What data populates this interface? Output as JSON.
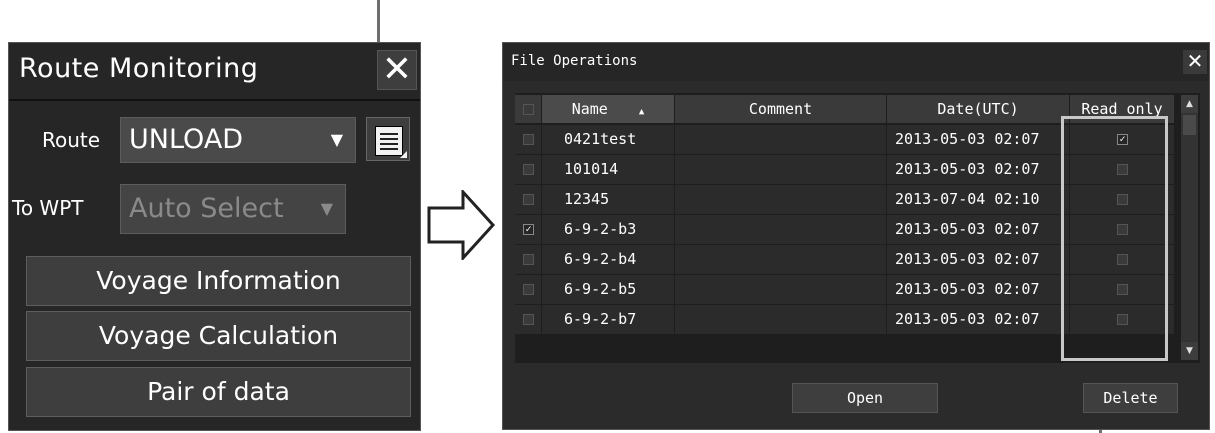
{
  "route_monitoring": {
    "title": "Route Monitoring",
    "close_glyph": "✕",
    "route_label": "Route",
    "route_value": "UNLOAD",
    "to_wpt_label": "To WPT",
    "to_wpt_value": "Auto Select",
    "buttons": [
      "Voyage Information",
      "Voyage Calculation",
      "Pair of data"
    ]
  },
  "file_operations": {
    "title": "File Operations",
    "close_glyph": "✕",
    "columns": {
      "name": "Name",
      "comment": "Comment",
      "date": "Date(UTC)",
      "read_only": "Read only"
    },
    "rows": [
      {
        "name": "0421test",
        "comment": "",
        "date": "2013-05-03 02:07",
        "selected": false,
        "read_only": true
      },
      {
        "name": "101014",
        "comment": "",
        "date": "2013-05-03 02:07",
        "selected": false,
        "read_only": false
      },
      {
        "name": "12345",
        "comment": "",
        "date": "2013-07-04 02:10",
        "selected": false,
        "read_only": false
      },
      {
        "name": "6-9-2-b3",
        "comment": "",
        "date": "2013-05-03 02:07",
        "selected": true,
        "read_only": false
      },
      {
        "name": "6-9-2-b4",
        "comment": "",
        "date": "2013-05-03 02:07",
        "selected": false,
        "read_only": false
      },
      {
        "name": "6-9-2-b5",
        "comment": "",
        "date": "2013-05-03 02:07",
        "selected": false,
        "read_only": false
      },
      {
        "name": "6-9-2-b7",
        "comment": "",
        "date": "2013-05-03 02:07",
        "selected": false,
        "read_only": false
      }
    ],
    "open_label": "Open",
    "delete_label": "Delete"
  },
  "colors": {
    "panel_bg": "#262626",
    "button_bg": "#3e3e3e",
    "highlight": "#c8c8c8"
  }
}
